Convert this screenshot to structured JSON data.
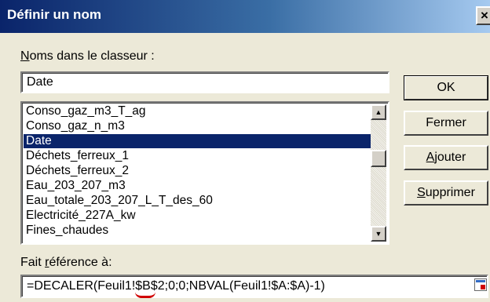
{
  "window": {
    "title": "Définir un nom",
    "close_glyph": "×"
  },
  "names_label": {
    "mnemonic": "N",
    "rest": "oms dans le classeur :"
  },
  "name_input": {
    "value": "Date"
  },
  "names_list": {
    "items": [
      "Conso_gaz_m3_T_ag",
      "Conso_gaz_n_m3",
      "Date",
      "Déchets_ferreux_1",
      "Déchets_ferreux_2",
      "Eau_203_207_m3",
      "Eau_totale_203_207_L_T_des_60",
      "Electricité_227A_kw",
      "Fines_chaudes"
    ],
    "selected_item": "Date"
  },
  "scrollbar": {
    "up_glyph": "▲",
    "down_glyph": "▼"
  },
  "buttons": {
    "ok": "OK",
    "close": "Fermer",
    "add_mnemonic": "A",
    "add_rest": "jouter",
    "delete_mnemonic": "S",
    "delete_rest": "upprimer"
  },
  "ref_label": {
    "before": "Fait ",
    "mnemonic": "r",
    "after": "éférence à:"
  },
  "ref_input": {
    "value": "=DECALER(Feuil1!$B$2;0;0;NBVAL(Feuil1!$A:$A)-1)"
  }
}
